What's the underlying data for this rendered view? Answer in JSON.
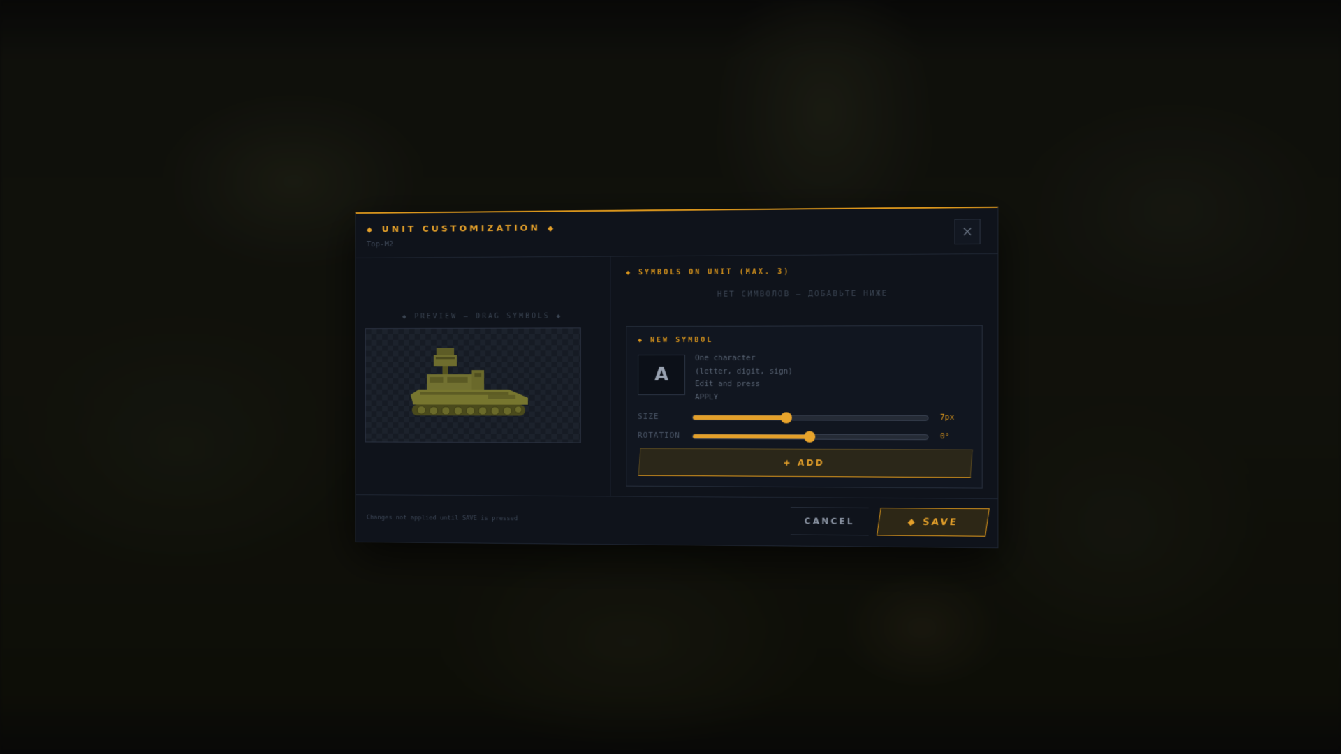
{
  "dialog": {
    "title": "UNIT CUSTOMIZATION",
    "subtitle": "Тор-М2"
  },
  "preview": {
    "label": "◆ PREVIEW — DRAG SYMBOLS ◆"
  },
  "symbols": {
    "section_title": "SYMBOLS ON UNIT (MAX. 3)",
    "empty_message": "НЕТ СИМВОЛОВ — ДОБАВЬТЕ НИЖЕ"
  },
  "new_symbol": {
    "title": "NEW SYMBOL",
    "character": "A",
    "hint_lines": [
      "One character",
      "(letter, digit, sign)",
      "Edit and press",
      "APPLY"
    ],
    "size_label": "SIZE",
    "size_value": "7px",
    "size_fraction": 0.4,
    "rotation_label": "ROTATION",
    "rotation_value": "0°",
    "rotation_fraction": 0.5,
    "add_label": "+ ADD"
  },
  "footer": {
    "note": "Changes not applied until SAVE is pressed",
    "cancel_label": "CANCEL",
    "save_label": "SAVE"
  },
  "colors": {
    "accent": "#e4a02a",
    "panel": "#0f131b",
    "tank": "#6b6a2c"
  }
}
